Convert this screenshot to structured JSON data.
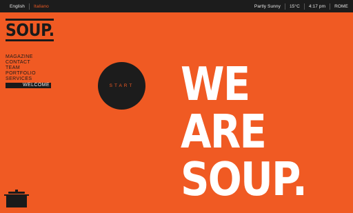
{
  "topbar": {
    "languages": [
      "English",
      "Italiano"
    ],
    "weather": "Partly Sunny",
    "temperature": "15°C",
    "time": "4:17 pm",
    "city": "ROME"
  },
  "logo": {
    "text": "SOUP."
  },
  "nav": {
    "items": [
      "MAGAZINE",
      "CONTACT",
      "TEAM",
      "PORTFOLIO",
      "SERVICES",
      "WELCOME"
    ],
    "active": "WELCOME"
  },
  "start_button": {
    "label": "START"
  },
  "hero": {
    "lines": [
      "WE",
      "ARE",
      "SOUP"
    ],
    "dot": "."
  },
  "colors": {
    "accent": "#f05a23",
    "dark": "#1c1c1c",
    "hero_text": "#ffffff"
  },
  "icons": {
    "footer": "cooking-pot-icon"
  }
}
